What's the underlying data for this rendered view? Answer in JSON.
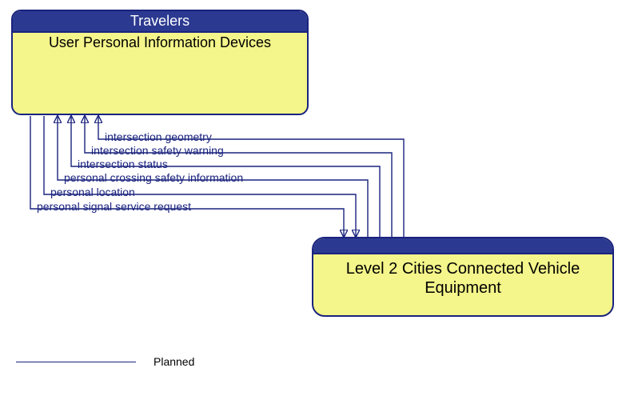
{
  "nodes": {
    "travelers": {
      "header": "Travelers",
      "body": "User Personal Information Devices"
    },
    "equipment": {
      "body_line1": "Level 2 Cities Connected Vehicle",
      "body_line2": "Equipment"
    }
  },
  "flows": {
    "f1": "intersection geometry",
    "f2": "intersection safety warning",
    "f3": "intersection status",
    "f4": "personal crossing safety information",
    "f5": "personal location",
    "f6": "personal signal service request"
  },
  "legend": {
    "planned": "Planned"
  },
  "chart_data": {
    "type": "diagram",
    "title": "",
    "nodes": [
      {
        "id": "A",
        "category": "Travelers",
        "label": "User Personal Information Devices"
      },
      {
        "id": "B",
        "category": "",
        "label": "Level 2 Cities Connected Vehicle Equipment"
      }
    ],
    "edges": [
      {
        "from": "B",
        "to": "A",
        "label": "intersection geometry",
        "status": "Planned"
      },
      {
        "from": "B",
        "to": "A",
        "label": "intersection safety warning",
        "status": "Planned"
      },
      {
        "from": "B",
        "to": "A",
        "label": "intersection status",
        "status": "Planned"
      },
      {
        "from": "B",
        "to": "A",
        "label": "personal crossing safety information",
        "status": "Planned"
      },
      {
        "from": "A",
        "to": "B",
        "label": "personal location",
        "status": "Planned"
      },
      {
        "from": "A",
        "to": "B",
        "label": "personal signal service request",
        "status": "Planned"
      }
    ],
    "legend": [
      {
        "style": "solid-line",
        "meaning": "Planned"
      }
    ]
  }
}
